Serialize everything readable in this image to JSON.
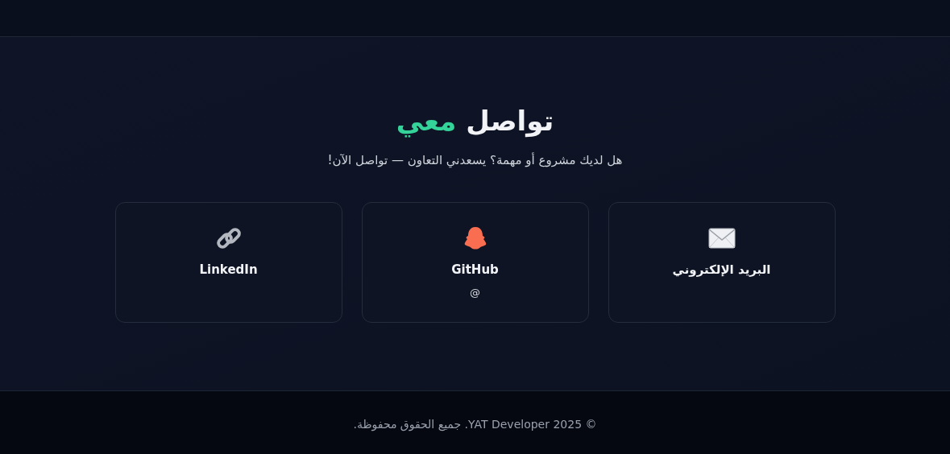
{
  "title": [
    {
      "text": "تواصل",
      "highlight": false
    },
    {
      "text": "معي",
      "highlight": true
    }
  ],
  "subtitle": "هل لديك مشروع أو مهمة؟ يسعدني التعاون — تواصل الآن!",
  "cards": [
    {
      "kind": "email",
      "label": "البريد الإلكتروني"
    },
    {
      "kind": "github",
      "label": "GitHub",
      "detail": "@"
    },
    {
      "kind": "linkedin",
      "label": "LinkedIn"
    }
  ],
  "footer": "© 2025 YAT Developer. جميع الحقوق محفوظة."
}
